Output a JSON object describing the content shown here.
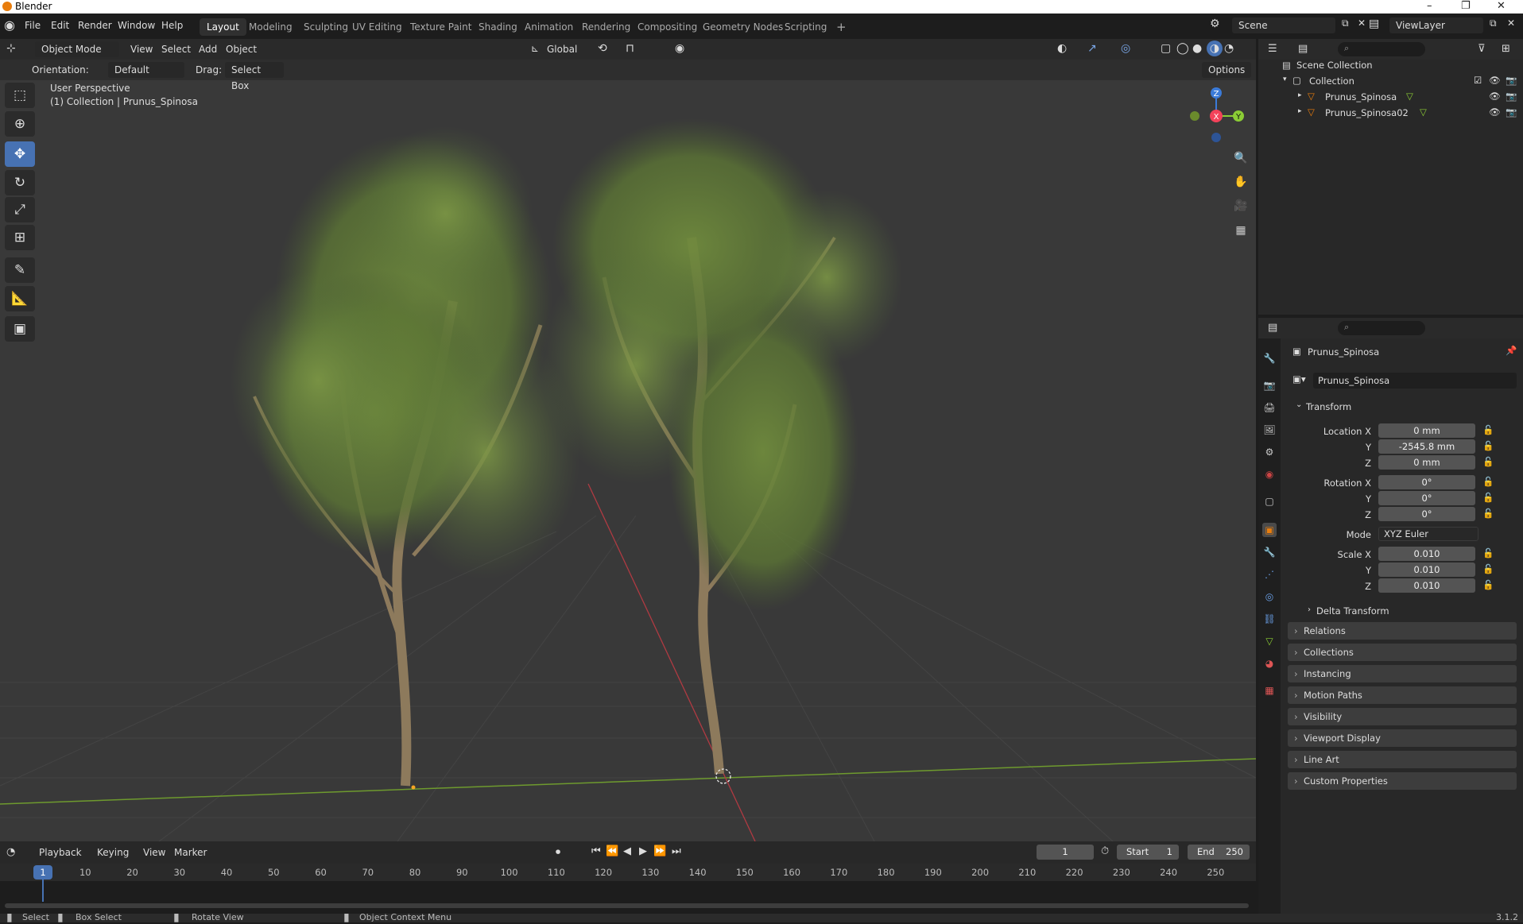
{
  "window": {
    "title": "Blender",
    "controls": [
      "–",
      "❐",
      "✕"
    ]
  },
  "menubar": {
    "items": [
      "File",
      "Edit",
      "Render",
      "Window",
      "Help"
    ]
  },
  "workspaces": [
    "Layout",
    "Modeling",
    "Sculpting",
    "UV Editing",
    "Texture Paint",
    "Shading",
    "Animation",
    "Rendering",
    "Compositing",
    "Geometry Nodes",
    "Scripting"
  ],
  "workspace_add": "+",
  "scene": {
    "name": "Scene",
    "view_layer": "ViewLayer"
  },
  "viewport": {
    "mode": "Object Mode",
    "menus": [
      "View",
      "Select",
      "Add",
      "Object"
    ],
    "transform_orientation": "Global",
    "orientation_label": "Orientation:",
    "orientation_value": "Default",
    "drag_label": "Drag:",
    "drag_value": "Select Box",
    "options": "Options",
    "view_name": "User Perspective",
    "collection_info": "(1) Collection | Prunus_Spinosa",
    "gizmo": {
      "z": "Z",
      "x": "X",
      "y": "Y"
    }
  },
  "outliner": {
    "root": "Scene Collection",
    "collection": "Collection",
    "objects": [
      "Prunus_Spinosa",
      "Prunus_Spinosa02"
    ]
  },
  "properties": {
    "object_name": "Prunus_Spinosa",
    "data_name": "Prunus_Spinosa",
    "transform_title": "Transform",
    "location": {
      "label_x": "Location X",
      "label_y": "Y",
      "label_z": "Z",
      "x": "0 mm",
      "y": "-2545.8 mm",
      "z": "0 mm"
    },
    "rotation": {
      "label_x": "Rotation X",
      "label_y": "Y",
      "label_z": "Z",
      "x": "0°",
      "y": "0°",
      "z": "0°"
    },
    "mode_label": "Mode",
    "mode_value": "XYZ Euler",
    "scale": {
      "label_x": "Scale X",
      "label_y": "Y",
      "label_z": "Z",
      "x": "0.010",
      "y": "0.010",
      "z": "0.010"
    },
    "delta_transform": "Delta Transform",
    "panels": [
      "Relations",
      "Collections",
      "Instancing",
      "Motion Paths",
      "Visibility",
      "Viewport Display",
      "Line Art",
      "Custom Properties"
    ]
  },
  "timeline": {
    "menus": [
      "Playback",
      "Keying",
      "View",
      "Marker"
    ],
    "current_frame": "1",
    "start_label": "Start",
    "start": "1",
    "end_label": "End",
    "end": "250",
    "ticks": [
      "1",
      "10",
      "20",
      "30",
      "40",
      "50",
      "60",
      "70",
      "80",
      "90",
      "100",
      "110",
      "120",
      "130",
      "140",
      "150",
      "160",
      "170",
      "180",
      "190",
      "200",
      "210",
      "220",
      "230",
      "240",
      "250"
    ]
  },
  "statusbar": {
    "select": "Select",
    "box_select": "Box Select",
    "rotate_view": "Rotate View",
    "context_menu": "Object Context Menu",
    "version": "3.1.2"
  },
  "colors": {
    "accent": "#4772b3",
    "x_axis": "#f3425a",
    "y_axis": "#8bcc35",
    "z_axis": "#3b7bd9",
    "orange": "#e87d0d"
  }
}
